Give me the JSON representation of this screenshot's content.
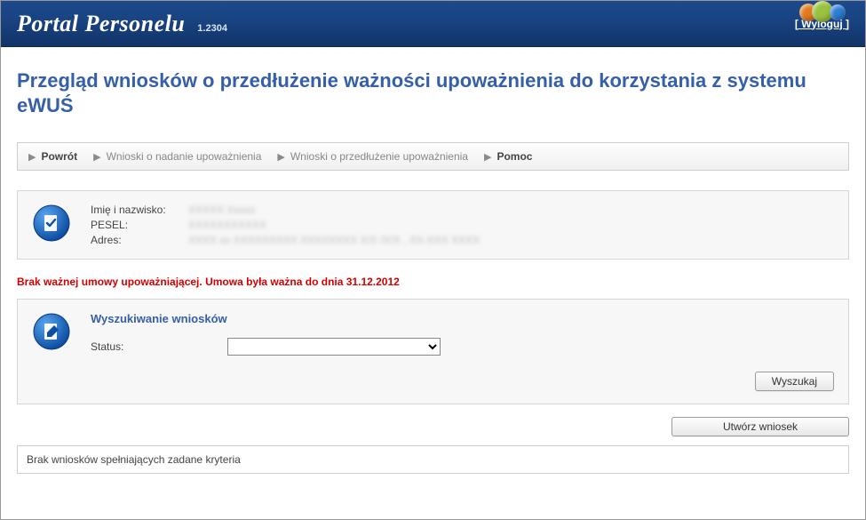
{
  "header": {
    "app_title": "Portal Personelu",
    "version": "1.2304",
    "logout": "[ Wyloguj ]"
  },
  "page": {
    "title": "Przegląd wniosków o przedłużenie ważności upoważnienia do korzystania z systemu eWUŚ"
  },
  "nav": {
    "back": "Powrót",
    "grant": "Wnioski o nadanie upoważnienia",
    "extend": "Wnioski o przedłużenie upoważnienia",
    "help": "Pomoc"
  },
  "info": {
    "name_label": "Imię i nazwisko:",
    "pesel_label": "PESEL:",
    "address_label": "Adres:",
    "name_value": "XXXXX Xxxxx",
    "pesel_value": "XXXXXXXXXXX",
    "address_value": "XXXX xx XXXXXXXXX XXXXXXXX X/X /X/X , XX-XXX XXXX"
  },
  "warning": "Brak ważnej umowy upoważniającej. Umowa była ważna do dnia 31.12.2012",
  "search": {
    "title": "Wyszukiwanie wniosków",
    "status_label": "Status:",
    "status_value": "",
    "search_btn": "Wyszukaj"
  },
  "actions": {
    "create": "Utwórz wniosek"
  },
  "results": {
    "empty": "Brak wniosków spełniających zadane kryteria"
  }
}
